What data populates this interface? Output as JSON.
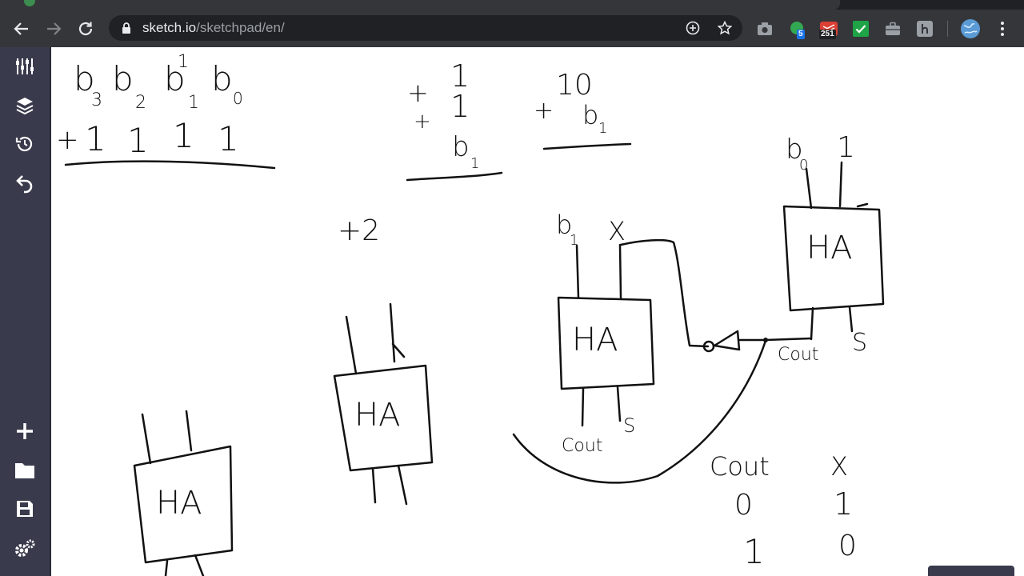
{
  "browser": {
    "url_host": "sketch.io",
    "url_path": "/sketchpad/en/",
    "nav": [
      "back-icon",
      "forward-icon",
      "reload-icon"
    ],
    "omnibox_icons": [
      "add-circle-icon",
      "star-icon"
    ],
    "extensions": [
      {
        "name": "camera-extension-icon",
        "badge": ""
      },
      {
        "name": "circle-extension-icon",
        "badge": "5"
      },
      {
        "name": "todoist-extension-icon",
        "badge": "251"
      },
      {
        "name": "checkmark-extension-icon",
        "badge": ""
      },
      {
        "name": "briefcase-extension-icon",
        "badge": ""
      },
      {
        "name": "h-extension-icon",
        "badge": ""
      }
    ],
    "colors": {
      "tab_bg": "#35363a",
      "omnibox_bg": "#202124",
      "badge_blue": "#1a73e8",
      "todoist_red": "#db4035",
      "check_green": "#1ea446"
    }
  },
  "sidebar": {
    "top_tools": [
      "tools-icon",
      "layers-icon",
      "history-icon",
      "undo-icon"
    ],
    "bottom_tools": [
      "add-icon",
      "folder-icon",
      "save-icon",
      "settings-icon"
    ],
    "bg": "#3a3a4d"
  },
  "sketch": {
    "row1": [
      "b",
      "3",
      "b",
      "2",
      "b",
      "1",
      "1",
      "b",
      "0"
    ],
    "row2": [
      "+",
      "1",
      "1",
      "1",
      "1"
    ],
    "mid_col": [
      "1",
      "+",
      "1",
      "+",
      "b",
      "1"
    ],
    "right_col": [
      "10",
      "+",
      "b",
      "1"
    ],
    "plus_two": "+2",
    "ha_label": "HA",
    "ha_right_inputs": [
      "b",
      "0",
      "1"
    ],
    "ha_right_outputs": [
      "Cout",
      "S"
    ],
    "ha_mid_inputs": [
      "b",
      "1",
      "X"
    ],
    "ha_mid_outputs": [
      "Cout",
      "S"
    ],
    "truth_table": {
      "headers": [
        "Cout",
        "X"
      ],
      "rows": [
        [
          "0",
          "1"
        ],
        [
          "1",
          "0"
        ]
      ]
    }
  }
}
